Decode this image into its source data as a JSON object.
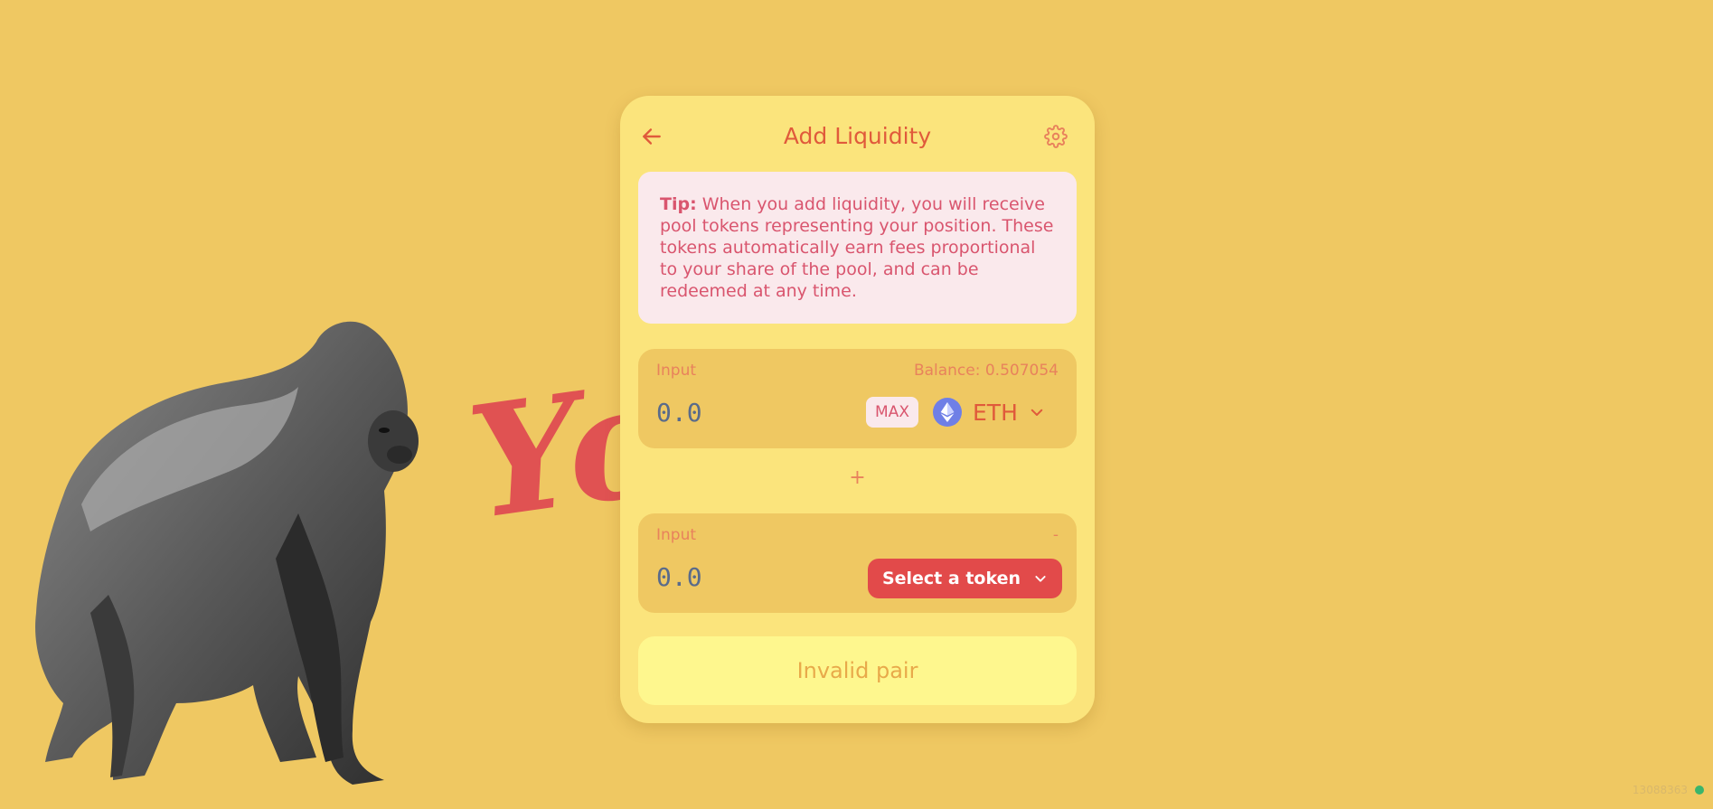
{
  "background": {
    "color": "#efc862"
  },
  "decoration": {
    "script_word": "Yo"
  },
  "header": {
    "title": "Add Liquidity",
    "back_icon": "arrow-left-icon",
    "settings_icon": "gear-icon"
  },
  "tip": {
    "label": "Tip:",
    "text": " When you add liquidity, you will receive pool tokens representing your position. These tokens automatically earn fees proportional to your share of the pool, and can be redeemed at any time."
  },
  "input_a": {
    "label": "Input",
    "balance": "Balance: 0.507054",
    "placeholder": "0.0",
    "max_label": "MAX",
    "token_symbol": "ETH",
    "token_icon": "ethereum-icon"
  },
  "separator": {
    "symbol": "+"
  },
  "input_b": {
    "label": "Input",
    "balance": "-",
    "placeholder": "0.0",
    "select_label": "Select a token"
  },
  "submit": {
    "label": "Invalid pair"
  },
  "footer": {
    "block_number": "13088363"
  },
  "colors": {
    "accent": "#e05a3b",
    "card": "#fbe47c",
    "panel": "#efc862",
    "select_button": "#e24a4a",
    "status_ok": "#3ab56b"
  }
}
